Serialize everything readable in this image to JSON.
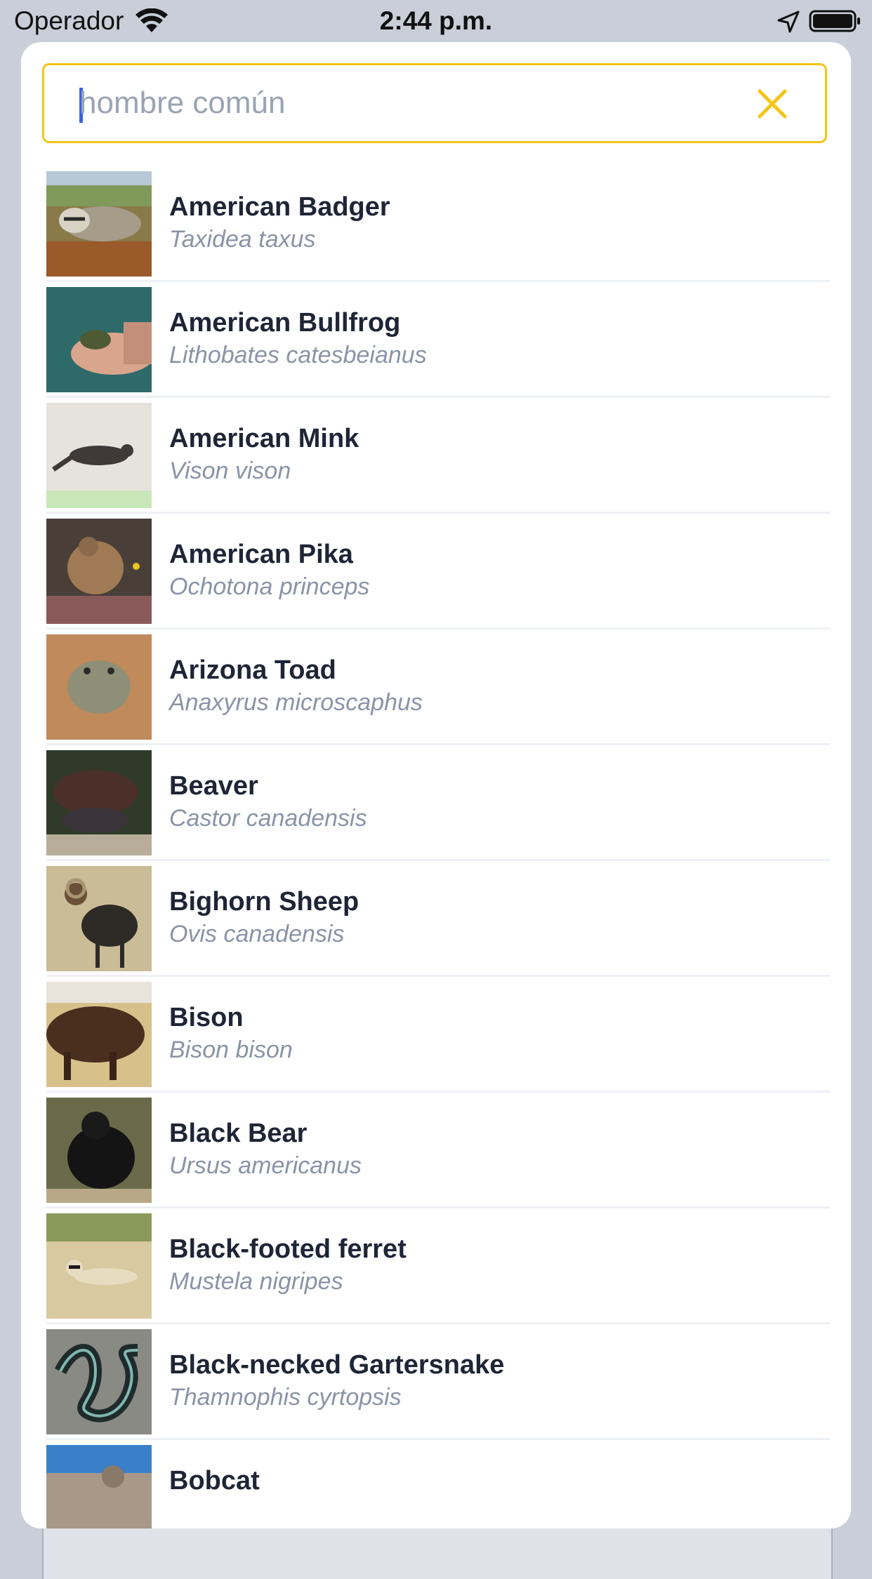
{
  "status_bar": {
    "carrier": "Operador",
    "time": "2:44 p.m.",
    "icons": [
      "wifi-icon",
      "location-arrow-icon",
      "battery-icon"
    ]
  },
  "search": {
    "placeholder": "hombre común",
    "value": "",
    "accent_color": "#f5c518",
    "clear_icon": "close-icon"
  },
  "species": [
    {
      "common": "American Badger",
      "scientific": "Taxidea taxus"
    },
    {
      "common": "American Bullfrog",
      "scientific": "Lithobates catesbeianus"
    },
    {
      "common": "American Mink",
      "scientific": "Vison vison"
    },
    {
      "common": "American Pika",
      "scientific": "Ochotona princeps"
    },
    {
      "common": "Arizona Toad",
      "scientific": "Anaxyrus microscaphus"
    },
    {
      "common": "Beaver",
      "scientific": "Castor canadensis"
    },
    {
      "common": "Bighorn Sheep",
      "scientific": "Ovis canadensis"
    },
    {
      "common": "Bison",
      "scientific": "Bison bison"
    },
    {
      "common": "Black Bear",
      "scientific": "Ursus americanus"
    },
    {
      "common": "Black-footed ferret",
      "scientific": "Mustela nigripes"
    },
    {
      "common": "Black-necked Gartersnake",
      "scientific": "Thamnophis cyrtopsis"
    },
    {
      "common": "Bobcat",
      "scientific": ""
    }
  ],
  "colors": {
    "sheet_bg": "#ffffff",
    "screen_bg": "#c9ced9",
    "common_name": "#1f2537",
    "scientific_name": "#8b93a7"
  }
}
